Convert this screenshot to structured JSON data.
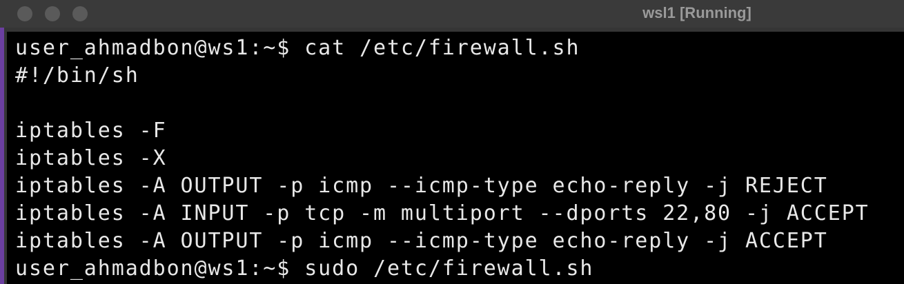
{
  "window": {
    "title": "wsl1 [Running]"
  },
  "terminal": {
    "lines": [
      "user_ahmadbon@ws1:~$ cat /etc/firewall.sh",
      "#!/bin/sh",
      "",
      "iptables -F",
      "iptables -X",
      "iptables -A OUTPUT -p icmp --icmp-type echo-reply -j REJECT",
      "iptables -A INPUT -p tcp -m multiport --dports 22,80 -j ACCEPT",
      "iptables -A OUTPUT -p icmp --icmp-type echo-reply -j ACCEPT",
      "user_ahmadbon@ws1:~$ sudo /etc/firewall.sh"
    ]
  },
  "colors": {
    "terminal_background": "#000000",
    "terminal_text": "#e8e8e8",
    "titlebar": "#3a3a3a",
    "title_text": "#9a9a9a",
    "traffic_light_inactive": "#5a5a5a"
  }
}
